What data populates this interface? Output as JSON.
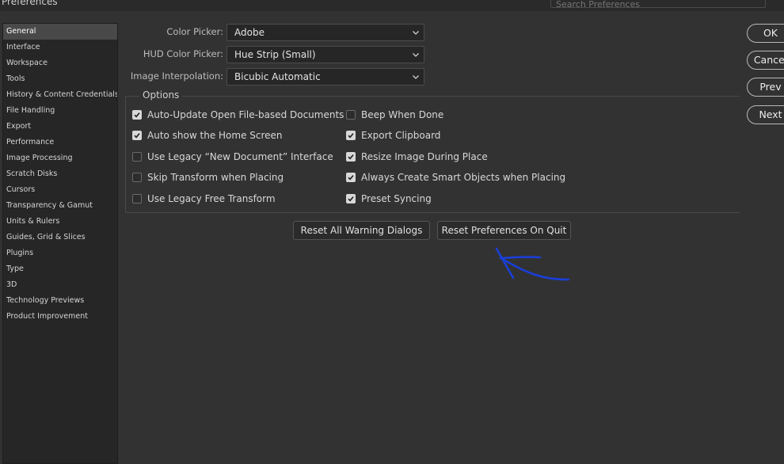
{
  "window": {
    "title": "Preferences"
  },
  "search": {
    "placeholder": "Search Preferences"
  },
  "sidebar": {
    "items": [
      {
        "label": "General",
        "selected": true
      },
      {
        "label": "Interface"
      },
      {
        "label": "Workspace"
      },
      {
        "label": "Tools"
      },
      {
        "label": "History & Content Credentials"
      },
      {
        "label": "File Handling"
      },
      {
        "label": "Export"
      },
      {
        "label": "Performance"
      },
      {
        "label": "Image Processing"
      },
      {
        "label": "Scratch Disks"
      },
      {
        "label": "Cursors"
      },
      {
        "label": "Transparency & Gamut"
      },
      {
        "label": "Units & Rulers"
      },
      {
        "label": "Guides, Grid & Slices"
      },
      {
        "label": "Plugins"
      },
      {
        "label": "Type"
      },
      {
        "label": "3D"
      },
      {
        "label": "Technology Previews"
      },
      {
        "label": "Product Improvement"
      }
    ]
  },
  "fields": {
    "color_picker": {
      "label": "Color Picker:",
      "value": "Adobe"
    },
    "hud_color_picker": {
      "label": "HUD Color Picker:",
      "value": "Hue Strip (Small)"
    },
    "image_interpolation": {
      "label": "Image Interpolation:",
      "value": "Bicubic Automatic"
    }
  },
  "options": {
    "title": "Options",
    "left": [
      {
        "label": "Auto-Update Open File-based Documents",
        "checked": true
      },
      {
        "label": "Auto show the Home Screen",
        "checked": true
      },
      {
        "label": "Use Legacy “New Document” Interface",
        "checked": false
      },
      {
        "label": "Skip Transform when Placing",
        "checked": false
      },
      {
        "label": "Use Legacy Free Transform",
        "checked": false
      }
    ],
    "right": [
      {
        "label": "Beep When Done",
        "checked": false
      },
      {
        "label": "Export Clipboard",
        "checked": true
      },
      {
        "label": "Resize Image During Place",
        "checked": true
      },
      {
        "label": "Always Create Smart Objects when Placing",
        "checked": true
      },
      {
        "label": "Preset Syncing",
        "checked": true
      }
    ]
  },
  "buttons": {
    "reset_warnings": "Reset All Warning Dialogs",
    "reset_prefs": "Reset Preferences On Quit",
    "ok": "OK",
    "cancel": "Cancel",
    "prev": "Prev",
    "next": "Next"
  },
  "annotation": {
    "color": "#1a3fd6",
    "icon": "hand-drawn-arrow-icon"
  }
}
